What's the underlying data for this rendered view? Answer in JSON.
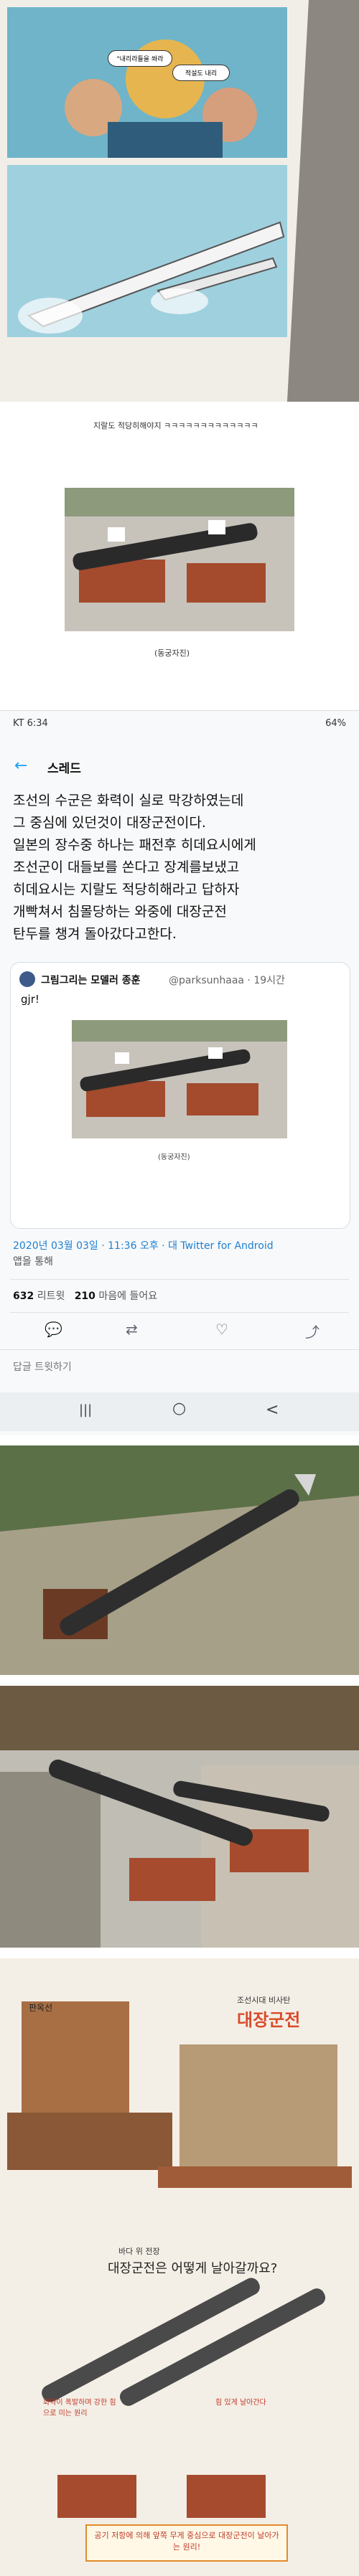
{
  "comic_panel": {
    "speech1": "\"내리라들을 쏴라",
    "speech2": "적설도 내리",
    "caption": "지랄도 적당히해야지 ㅋㅋㅋㅋㅋㅋㅋㅋㅋㅋㅋㅋㅋ",
    "photo_caption": "(동궁자진)"
  },
  "twitter": {
    "status": {
      "carrier": "KT 6:34",
      "battery": "64%"
    },
    "header_title": "스레드",
    "tweet_text": [
      "조선의 수군은 화력이 실로 막강하였는데",
      "그 중심에 있던것이 대장군전이다.",
      "일본의 장수중 하나는 패전후 히데요시에게",
      "조선군이 대들보를 쏜다고 장계를보냈고",
      "히데요시는 지랄도 적당히해라고 답하자",
      "개빡쳐서 침몰당하는 와중에 대장군전",
      "탄두를 챙겨 돌아갔다고한다."
    ],
    "quoted": {
      "name": "그림그리는 모델러 종훈",
      "handle": "@parksunhaaa · 19시간",
      "text": "gjr!",
      "photo_caption": "(동궁자진)"
    },
    "timestamp": "2020년 03월 03일 · 11:36 오후 · ",
    "source": "대 Twitter for Android",
    "via": "앱을 통해",
    "retweets_count": "632",
    "retweets_label": "리트윗",
    "likes_count": "210",
    "likes_label": "마음에 들어요",
    "reply_placeholder": "답글 트윗하기",
    "nav": {
      "recent": "|||",
      "home": "○",
      "back": "<"
    }
  },
  "illustration": {
    "ship_label": "판옥선",
    "title_top": "조선시대 비사탄",
    "title_main": "대장군전",
    "title_bubble": "바다 위 전장",
    "question": "대장군전은 어떻게 날아갈까요?",
    "note_left": "화약이 폭발하며 강한 힘으로 미는 원리",
    "note_right": "힘 있게 날아간다",
    "bottom_box": "공기 저항에 의해 앞쪽 무게 중심으로 대장군전이 날아가는 원리!"
  },
  "colors": {
    "tw_blue": "#1da1f2",
    "link_blue": "#1d7fd1",
    "cannon_red": "#b2452a",
    "paper": "#f4efe6"
  }
}
